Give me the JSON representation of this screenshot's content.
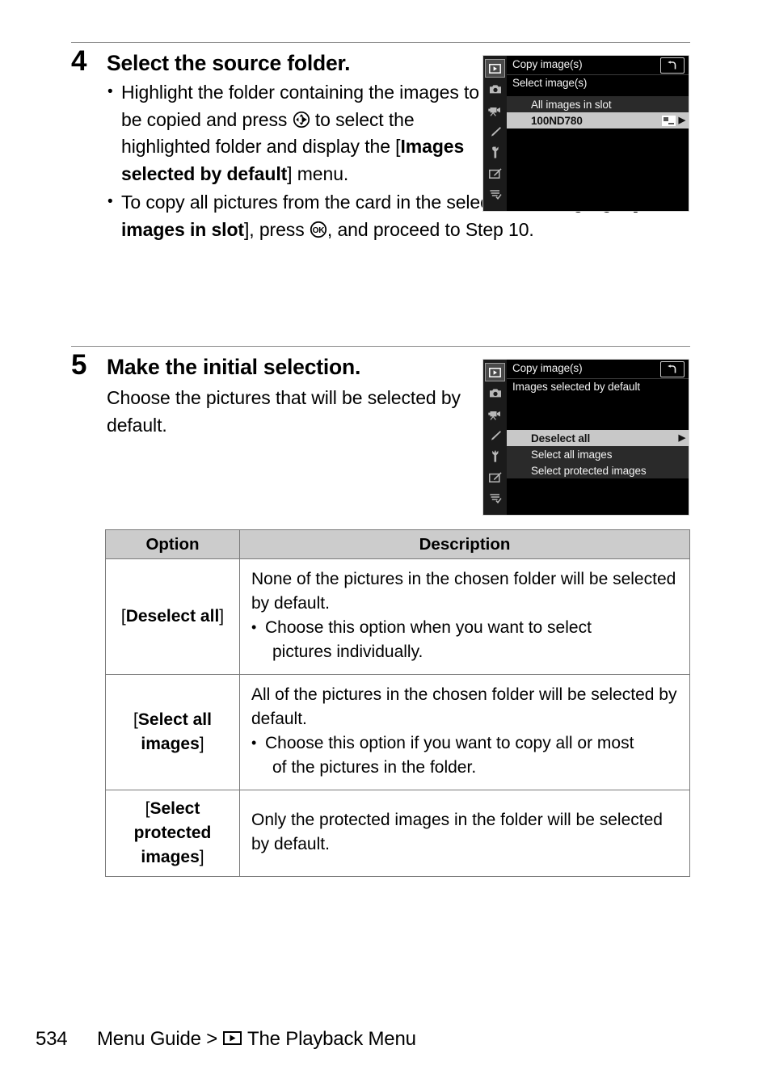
{
  "page": {
    "number": "534",
    "footer_breadcrumb_prefix": "Menu Guide >",
    "footer_breadcrumb_icon": "playback-icon",
    "footer_breadcrumb_suffix": "The Playback Menu"
  },
  "steps": [
    {
      "number": "4",
      "title": "Select the source folder.",
      "bullets": [
        {
          "parts": [
            {
              "type": "text",
              "text": "Highlight the folder containing the images to be copied and press "
            },
            {
              "type": "icon",
              "name": "multi-selector-right-icon"
            },
            {
              "type": "text",
              "text": " to select the highlighted folder and display the ["
            },
            {
              "type": "bold",
              "text": "Images selected by default"
            },
            {
              "type": "text",
              "text": "] menu."
            }
          ],
          "plain": "Highlight the folder containing the images to be copied and press ⊕ to select the highlighted folder and display the [Images selected by default] menu."
        },
        {
          "parts": [
            {
              "type": "text",
              "text": "To copy all pictures from the card in the selected slot, highlight ["
            },
            {
              "type": "bold",
              "text": "All images in slot"
            },
            {
              "type": "text",
              "text": "], press "
            },
            {
              "type": "icon",
              "name": "ok-button-icon"
            },
            {
              "type": "text",
              "text": ", and proceed to Step 10."
            }
          ],
          "plain": "To copy all pictures from the card in the selected slot, highlight [All images in slot], press OK, and proceed to Step 10."
        }
      ]
    },
    {
      "number": "5",
      "title": "Make the initial selection.",
      "paragraph": "Choose the pictures that will be selected by default."
    }
  ],
  "lcd_screens": [
    {
      "id": "select-images",
      "title": "Copy image(s)",
      "back_icon": "return-arrow-icon",
      "subtitle": "Select image(s)",
      "sidebar_icons": [
        "playback-menu-icon",
        "photo-shooting-menu-icon",
        "movie-shooting-menu-icon",
        "custom-settings-menu-icon",
        "setup-menu-icon",
        "retouch-menu-icon",
        "recent-settings-menu-icon"
      ],
      "rows": [
        {
          "label": "All images in slot",
          "state": "dark",
          "arrow": false,
          "thumb": false
        },
        {
          "label": "100ND780",
          "state": "selected",
          "arrow": true,
          "thumb": true
        }
      ]
    },
    {
      "id": "images-selected-by-default",
      "title": "Copy image(s)",
      "back_icon": "return-arrow-icon",
      "subtitle": "Images selected by default",
      "sidebar_icons": [
        "playback-menu-icon",
        "photo-shooting-menu-icon",
        "movie-shooting-menu-icon",
        "custom-settings-menu-icon",
        "setup-menu-icon",
        "retouch-menu-icon",
        "recent-settings-menu-icon"
      ],
      "rows": [
        {
          "label": "Deselect all",
          "state": "selected",
          "arrow": true,
          "thumb": false
        },
        {
          "label": "Select all images",
          "state": "dark",
          "arrow": false,
          "thumb": false
        },
        {
          "label": "Select protected images",
          "state": "dark",
          "arrow": false,
          "thumb": false
        }
      ]
    }
  ],
  "table": {
    "headers": [
      "Option",
      "Description"
    ],
    "rows": [
      {
        "option_open": "[",
        "option_bold": "Deselect all",
        "option_close": "]",
        "desc_paragraph": "None of the pictures in the chosen folder will be selected by default.",
        "desc_bullet_line1": "Choose this option when you want to select",
        "desc_bullet_line2": "pictures individually."
      },
      {
        "option_open": "[",
        "option_bold": "Select all images",
        "option_close": "]",
        "desc_paragraph": "All of the pictures in the chosen folder will be selected by default.",
        "desc_bullet_line1": "Choose this option if you want to copy all or most",
        "desc_bullet_line2": "of the pictures in the folder."
      },
      {
        "option_open": "[",
        "option_bold": "Select protected images",
        "option_close": "]",
        "desc_paragraph": "Only the protected images in the folder will be selected by default.",
        "desc_bullet_line1": "",
        "desc_bullet_line2": ""
      }
    ]
  },
  "colors": {
    "rule": "#8a8a8a",
    "table_header_bg": "#cccccc",
    "table_border": "#7a7a7a",
    "lcd_bg": "#000000",
    "lcd_sidebar_bg": "#1b1b1b",
    "lcd_row_dark": "#2a2a2a",
    "lcd_row_selected": "#c8c8c8",
    "lcd_text": "#f2f2f2"
  }
}
